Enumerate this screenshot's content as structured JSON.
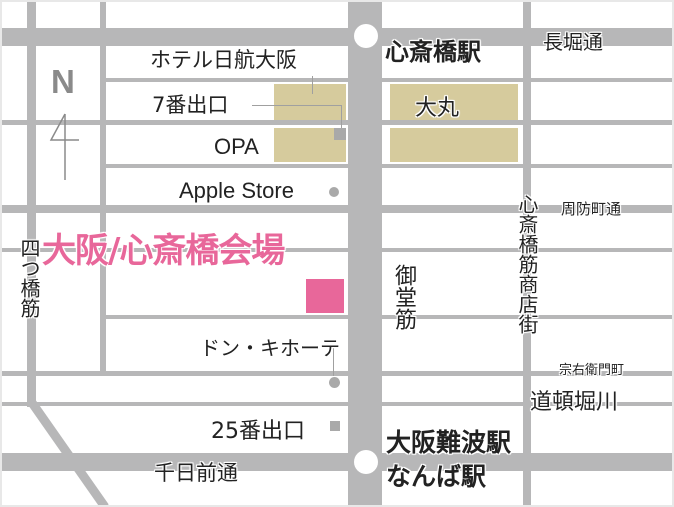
{
  "map": {
    "title": "大阪/心斎橋会場",
    "venue_color": "#e8679a",
    "road_color": "#b7b7b8",
    "building_color": "#d6cb9d",
    "compass": {
      "label": "N",
      "icon": "north-arrow-icon"
    },
    "stations": [
      {
        "name": "心斎橋駅"
      },
      {
        "name": "大阪難波駅",
        "name2": "なんば駅"
      }
    ],
    "streets": {
      "nagahori": "長堀通",
      "suomachi": "周防町通",
      "soemoncho": "宗右衛門町",
      "dotonbori": "道頓堀川",
      "sennichimae": "千日前通",
      "midosuji": "御堂筋",
      "yotsubashi": "四つ橋筋",
      "shinsaibashi_shotengai": "心斎橋筋商店街"
    },
    "landmarks": {
      "hotel_nikko": "ホテル日航大阪",
      "exit7": "7番出口",
      "opa": "OPA",
      "daimaru": "大丸",
      "apple_store": "Apple Store",
      "donki": "ドン・キホーテ",
      "exit25": "25番出口"
    }
  }
}
